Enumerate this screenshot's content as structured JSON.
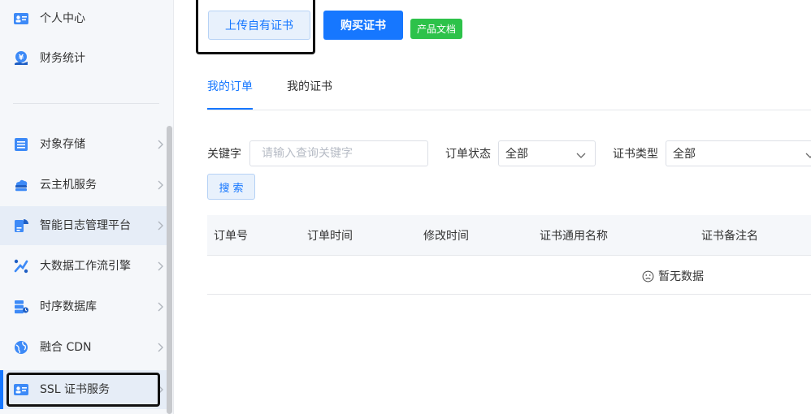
{
  "sidebar": {
    "items": [
      {
        "label": "个人中心"
      },
      {
        "label": "财务统计"
      },
      {
        "label": "对象存储"
      },
      {
        "label": "云主机服务"
      },
      {
        "label": "智能日志管理平台"
      },
      {
        "label": "大数据工作流引擎"
      },
      {
        "label": "时序数据库"
      },
      {
        "label": "融合 CDN"
      },
      {
        "label": "SSL 证书服务"
      }
    ]
  },
  "toolbar": {
    "upload_label": "上传自有证书",
    "buy_label": "购买证书",
    "doc_label": "产品文档"
  },
  "tabs": [
    {
      "label": "我的订单"
    },
    {
      "label": "我的证书"
    }
  ],
  "filters": {
    "keyword_label": "关键字",
    "keyword_placeholder": "请输入查询关键字",
    "status_label": "订单状态",
    "status_value": "全部",
    "type_label": "证书类型",
    "type_value": "全部",
    "search_label": "搜索"
  },
  "table": {
    "headers": [
      "订单号",
      "订单时间",
      "修改时间",
      "证书通用名称",
      "证书备注名"
    ],
    "empty_text": "暂无数据"
  },
  "colors": {
    "primary": "#1677ff",
    "success": "#2dc24a",
    "sidebar_bg": "#f5f7fa"
  }
}
